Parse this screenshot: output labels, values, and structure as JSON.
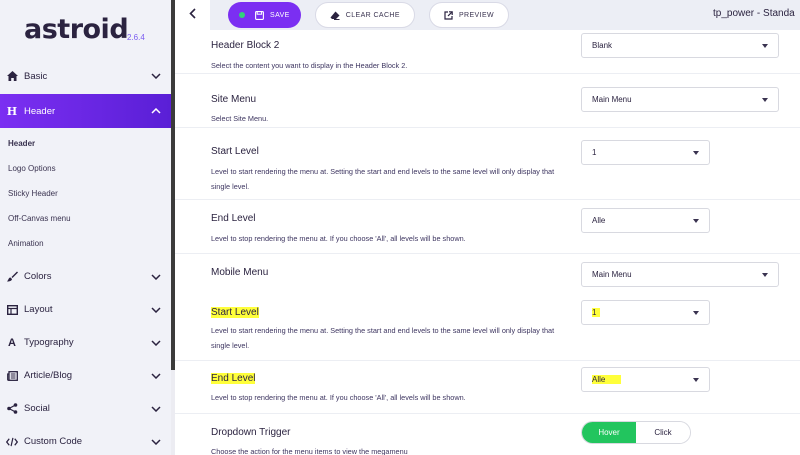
{
  "logo": {
    "name": "astroid",
    "version": "2.6.4"
  },
  "sidebar": {
    "basic": "Basic",
    "header": "Header",
    "header_sub": [
      "Header",
      "Logo Options",
      "Sticky Header",
      "Off-Canvas menu",
      "Animation"
    ],
    "colors": "Colors",
    "layout": "Layout",
    "typography": "Typography",
    "article_blog": "Article/Blog",
    "social": "Social",
    "custom_code": "Custom Code"
  },
  "toolbar": {
    "save": "SAVE",
    "clear_cache": "CLEAR CACHE",
    "preview": "PREVIEW",
    "template_name": "tp_power - Standa"
  },
  "settings": {
    "header_block_2": {
      "title": "Header Block 2",
      "desc": "Select the content you want to display in the Header Block 2.",
      "value": "Blank"
    },
    "site_menu": {
      "title": "Site Menu",
      "desc": "Select Site Menu.",
      "value": "Main Menu"
    },
    "start_level": {
      "title": "Start Level",
      "desc": "Level to start rendering the menu at. Setting the start and end levels to the same level will only display that single level.",
      "value": "1"
    },
    "end_level": {
      "title": "End Level",
      "desc": "Level to stop rendering the menu at. If you choose 'All', all levels will be shown.",
      "value": "Alle"
    },
    "mobile_menu": {
      "title": "Mobile Menu",
      "value": "Main Menu"
    },
    "mobile_start_level": {
      "title": "Start Level",
      "desc": "Level to start rendering the menu at. Setting the start and end levels to the same level will only display that single level.",
      "value": "1"
    },
    "mobile_end_level": {
      "title": "End Level",
      "desc": "Level to stop rendering the menu at. If you choose 'All', all levels will be shown.",
      "value": "Alle"
    },
    "dropdown_trigger": {
      "title": "Dropdown Trigger",
      "desc": "Choose the action for the menu items to view the megamenu",
      "options": [
        "Hover",
        "Click"
      ],
      "selected": "Hover"
    }
  },
  "colors": {
    "accent": "#7b2ff2",
    "success": "#22c55e",
    "highlight": "#ffff3a"
  }
}
